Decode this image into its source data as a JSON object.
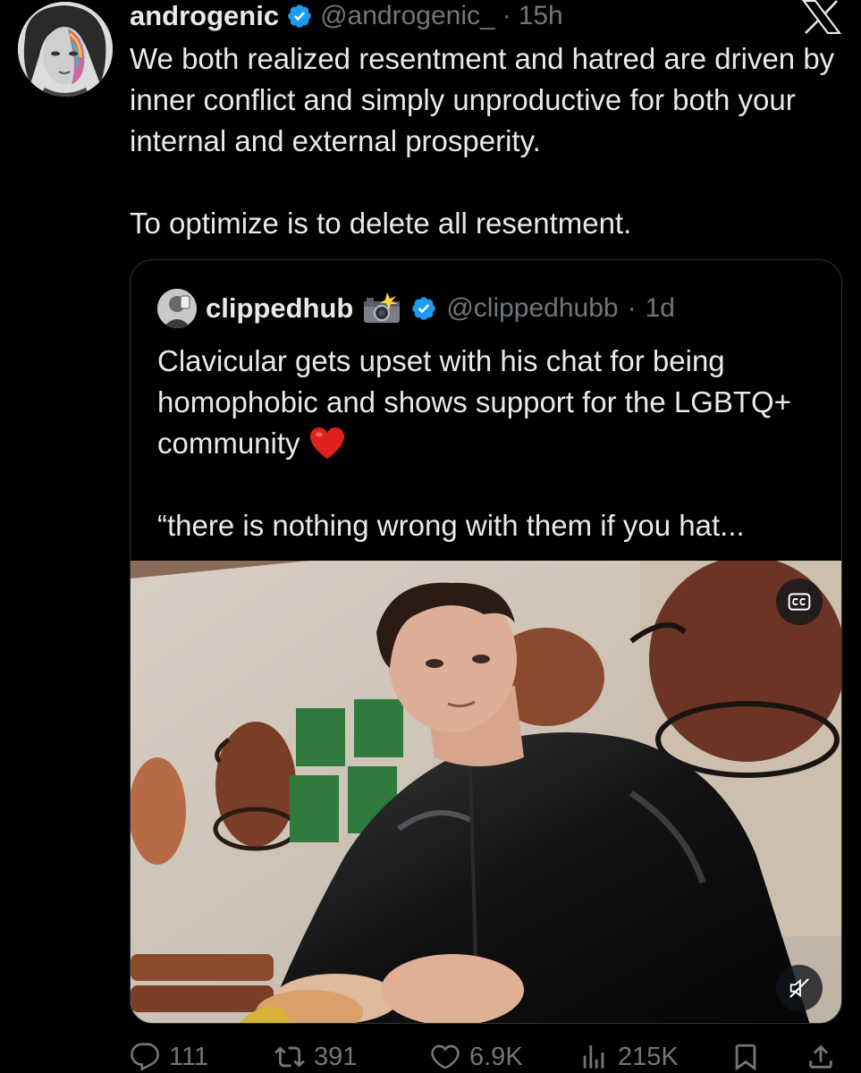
{
  "tweet": {
    "author_name": "androgenic",
    "handle": "@androgenic_",
    "separator": "·",
    "time": "15h",
    "text_paragraphs": [
      "We both realized resentment and hatred are driven by inner conflict and simply unproductive for both your internal and external prosperity.",
      "To optimize is to delete all resentment."
    ]
  },
  "quoted_tweet": {
    "author_name": "clippedhub",
    "handle": "@clippedhubb",
    "separator": "·",
    "time": "1d",
    "text_line1": "Clavicular gets upset with his chat for being homophobic and shows support for the LGBTQ+ community",
    "text_line2": "“there is nothing wrong with them if you hat...",
    "media": {
      "type": "video",
      "captions_icon": "cc-icon",
      "mute_icon": "muted-speaker-icon"
    }
  },
  "actions": {
    "replies": "111",
    "reposts": "391",
    "likes": "6.9K",
    "views": "215K"
  },
  "colors": {
    "background": "#000000",
    "text_primary": "#e7e9ea",
    "text_secondary": "#71767b",
    "verified_blue": "#1d9bf0",
    "border": "#2f3336"
  },
  "icons": [
    "x-logo-icon",
    "verified-badge-icon",
    "camera-flash-icon",
    "red-heart-icon",
    "cc-icon",
    "muted-speaker-icon",
    "reply-icon",
    "repost-icon",
    "like-icon",
    "views-icon",
    "bookmark-icon",
    "share-icon"
  ]
}
